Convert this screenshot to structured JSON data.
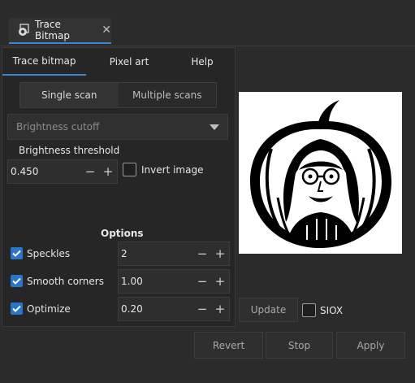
{
  "dock_tab": {
    "title": "Trace Bitmap",
    "close": "✕"
  },
  "tabs": [
    "Trace bitmap",
    "Pixel art",
    "Help"
  ],
  "scan_modes": {
    "single": "Single scan",
    "multiple": "Multiple scans"
  },
  "detection_mode": {
    "selected": "Brightness cutoff"
  },
  "brightness": {
    "label": "Brightness threshold",
    "value": "0.450"
  },
  "invert": {
    "label": "Invert image",
    "checked": false
  },
  "options": {
    "title": "Options",
    "speckles": {
      "label": "Speckles",
      "value": "2",
      "checked": true
    },
    "smooth_corners": {
      "label": "Smooth corners",
      "value": "1.00",
      "checked": true
    },
    "optimize": {
      "label": "Optimize",
      "value": "0.20",
      "checked": true
    }
  },
  "update_button": "Update",
  "siox": {
    "label": "SIOX",
    "checked": false
  },
  "actions": {
    "revert": "Revert",
    "stop": "Stop",
    "apply": "Apply"
  },
  "steppers": {
    "minus": "−",
    "plus": "+"
  },
  "colors": {
    "accent": "#3a86d0",
    "checkbox": "#2a75c8",
    "background": "#2b2b2b"
  }
}
